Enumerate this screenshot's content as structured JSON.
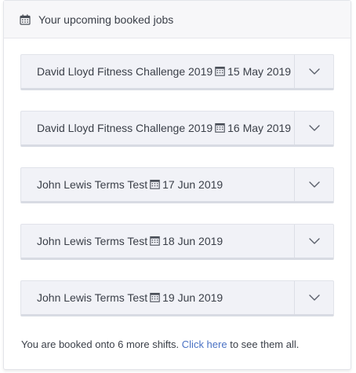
{
  "header": {
    "icon": "calendar-icon",
    "title": "Your upcoming booked jobs"
  },
  "jobs": [
    {
      "name": "David Lloyd Fitness Challenge 2019",
      "date": "15 May 2019",
      "icon": "calendar-icon",
      "toggle_icon": "chevron-down-icon"
    },
    {
      "name": "David Lloyd Fitness Challenge 2019",
      "date": "16 May 2019",
      "icon": "calendar-icon",
      "toggle_icon": "chevron-down-icon"
    },
    {
      "name": "John Lewis Terms Test",
      "date": "17 Jun 2019",
      "icon": "calendar-icon",
      "toggle_icon": "chevron-down-icon"
    },
    {
      "name": "John Lewis Terms Test",
      "date": "18 Jun 2019",
      "icon": "calendar-icon",
      "toggle_icon": "chevron-down-icon"
    },
    {
      "name": "John Lewis Terms Test",
      "date": "19 Jun 2019",
      "icon": "calendar-icon",
      "toggle_icon": "chevron-down-icon"
    }
  ],
  "footer": {
    "prefix": "You are booked onto 6 more shifts.",
    "link_text": "Click here",
    "suffix": "to see them all."
  },
  "colors": {
    "link": "#4a72c4",
    "text": "#3a3f48",
    "item_bg": "#f1f2f7",
    "header_bg": "#f7f7f9"
  }
}
